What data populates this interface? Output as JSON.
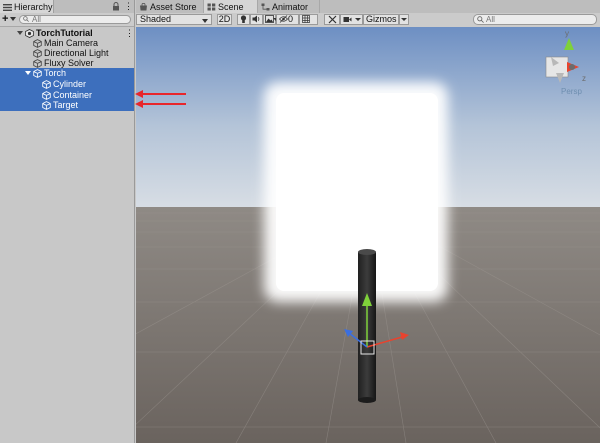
{
  "hierarchy": {
    "tab_label": "Hierarchy",
    "search_placeholder": "All",
    "add_label": "+",
    "menu_label": "⋮",
    "scene": {
      "name": "TorchTutorial",
      "menu": "⋮"
    },
    "items": [
      {
        "label": "Main Camera"
      },
      {
        "label": "Directional Light"
      },
      {
        "label": "Fluxy Solver"
      },
      {
        "label": "Torch"
      },
      {
        "label": "Cylinder"
      },
      {
        "label": "Container"
      },
      {
        "label": "Target"
      }
    ]
  },
  "tabs": [
    {
      "label": "Asset Store"
    },
    {
      "label": "Scene"
    },
    {
      "label": "Animator"
    }
  ],
  "scene_toolbar": {
    "shading": "Shaded",
    "two_d": "2D",
    "hidden_count": "0",
    "gizmos": "Gizmos",
    "search_placeholder": "All"
  },
  "viewport": {
    "projection_label": "Persp",
    "axis_labels": {
      "y": "y",
      "z": "z"
    }
  },
  "colors": {
    "selection": "#3d6fbd",
    "arrow": "#e8262b",
    "x_axis": "#e8432e",
    "y_axis": "#7fd13a",
    "z_axis": "#3b6fe0"
  }
}
